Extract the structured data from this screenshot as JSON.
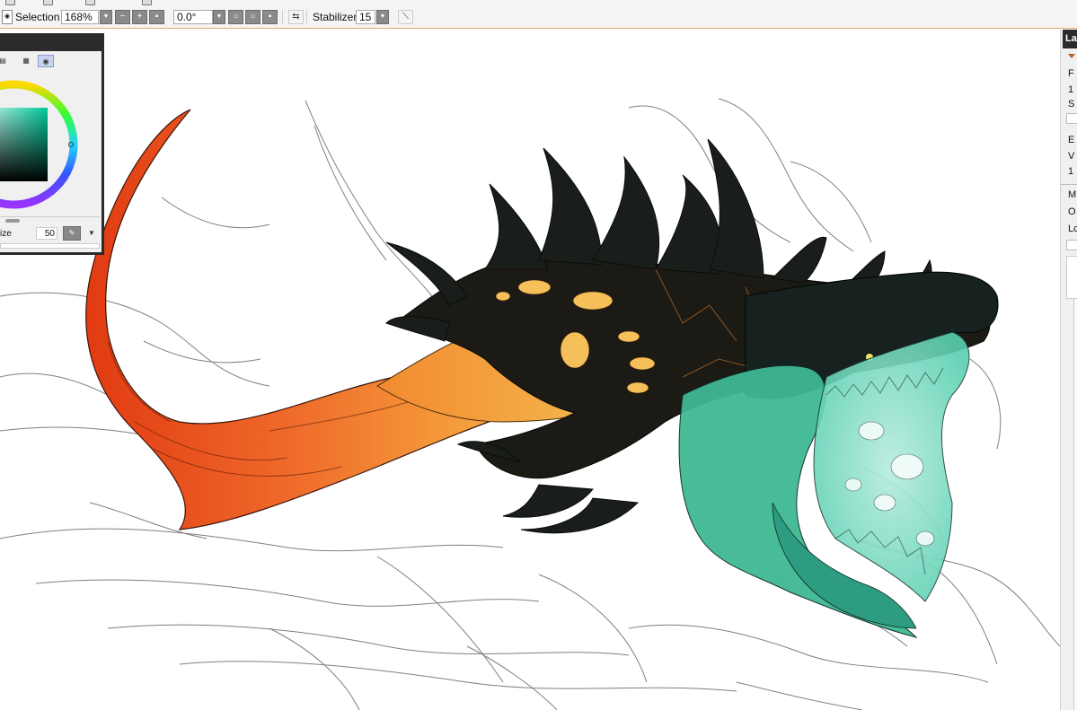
{
  "toolbar": {
    "selection_label": "Selection",
    "zoom_value": "168%",
    "rotation_value": "0.0°",
    "stabilizer_label": "Stabilizer",
    "stabilizer_value": "15"
  },
  "color_panel": {
    "size_label": "ize",
    "size_value": "50"
  },
  "layer_panel": {
    "title": "La",
    "labels": [
      "F",
      "1",
      "S",
      "E",
      "V",
      "1",
      "M",
      "O",
      "Lc"
    ]
  },
  "colors": {
    "accent_border": "#e0a878",
    "panel_dark": "#2b2b2b",
    "panel_light": "#f0f0f0",
    "button_gray": "#8a8a8a"
  },
  "icons": [
    "selection-icon",
    "zoom-minus-icon",
    "zoom-plus-icon",
    "zoom-reset-icon",
    "rotate-left-icon",
    "rotate-right-icon",
    "rotate-reset-icon",
    "flip-icon",
    "brush-icon",
    "color-wheel-icon"
  ]
}
